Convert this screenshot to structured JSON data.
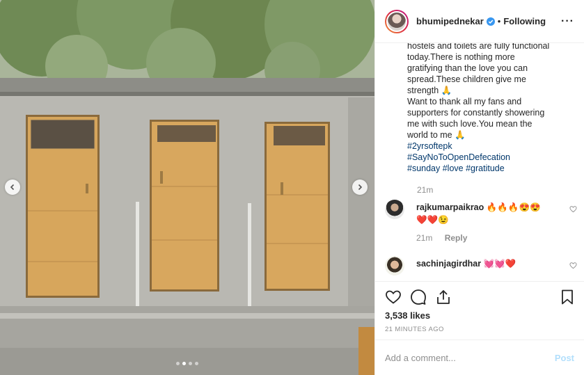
{
  "header": {
    "username": "bhumipednekar",
    "separator": "•",
    "follow_label": "Following",
    "more_label": "···"
  },
  "media": {
    "description_icons": [
      "chevron-left-icon",
      "chevron-right-icon"
    ],
    "carousel_count": 4,
    "carousel_active": 2
  },
  "caption": {
    "lines": [
      "hostels and toilets are fully functional",
      "today.There is nothing more",
      "gratifying than the love you can",
      "spread.These children give me",
      "strength 🙏",
      "Want to thank all my fans and",
      "supporters for constantly showering",
      "me with such love.You mean the",
      "world to me 🙏"
    ],
    "hashtags": [
      "#2yrsoftepk",
      "#SayNoToOpenDefecation",
      "#sunday #love #gratitude"
    ],
    "time": "21m"
  },
  "comments": [
    {
      "username": "rajkumarpaikrao",
      "text_line1": "🔥🔥🔥😍😍",
      "text_line2": "❤️❤️😉",
      "time": "21m",
      "reply_label": "Reply"
    },
    {
      "username": "sachinjagirdhar",
      "text_line1": "💓💓❤️"
    }
  ],
  "actions": {
    "likes": "3,538 likes",
    "posted_ago": "21 MINUTES AGO"
  },
  "add_comment": {
    "placeholder": "Add a comment...",
    "post_label": "Post"
  },
  "colors": {
    "link": "#00376b",
    "muted": "#8e8e8e",
    "post_disabled": "#b2dffc",
    "verified": "#3897f0",
    "door": "#d8a65b"
  }
}
